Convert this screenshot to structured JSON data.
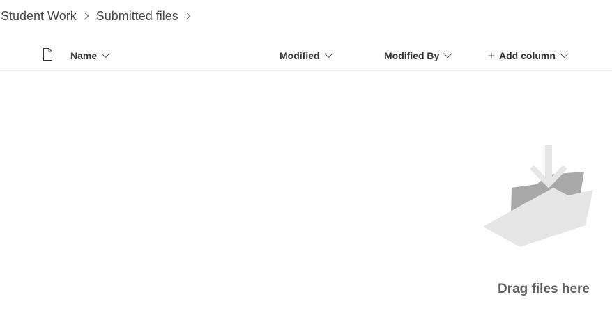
{
  "breadcrumb": {
    "items": [
      "Student Work",
      "Submitted files"
    ]
  },
  "columns": {
    "file_type_icon": "document-icon",
    "name": "Name",
    "modified": "Modified",
    "modified_by": "Modified By",
    "add_column": "Add column"
  },
  "empty_state": {
    "message": "Drag files here",
    "illustration_icon": "folder-download-illustration"
  },
  "colors": {
    "text_primary": "#323130",
    "text_secondary": "#605e5c",
    "divider": "#edebe9",
    "illustration_light": "#e6e6e6",
    "illustration_dark": "#a8a8a8"
  }
}
